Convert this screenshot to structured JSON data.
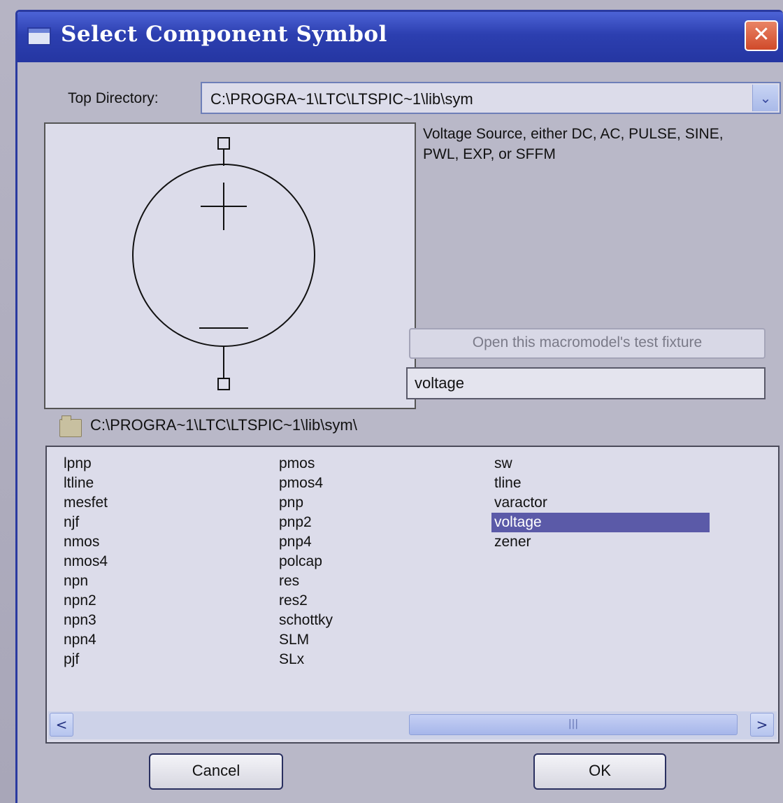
{
  "window": {
    "title": "Select Component Symbol",
    "close_label": "✕"
  },
  "top_directory": {
    "label": "Top Directory:",
    "value": "C:\\PROGRA~1\\LTC\\LTSPIC~1\\lib\\sym",
    "dropdown_arrow": "⌄"
  },
  "description": "Voltage Source, either DC, AC, PULSE, SINE, PWL, EXP, or SFFM",
  "test_fixture_button": "Open this macromodel's test fixture",
  "search": {
    "value": "voltage"
  },
  "current_path": "C:\\PROGRA~1\\LTC\\LTSPIC~1\\lib\\sym\\",
  "list": {
    "columns": [
      [
        "lpnp",
        "ltline",
        "mesfet",
        "njf",
        "nmos",
        "nmos4",
        "npn",
        "npn2",
        "npn3",
        "npn4",
        "pjf"
      ],
      [
        "pmos",
        "pmos4",
        "pnp",
        "pnp2",
        "pnp4",
        "polcap",
        "res",
        "res2",
        "schottky",
        "SLM",
        "SLx"
      ],
      [
        "sw",
        "tline",
        "varactor",
        "voltage",
        "zener"
      ]
    ],
    "selected": "voltage"
  },
  "scrollbar": {
    "left": "<",
    "right": ">",
    "grip": "|||"
  },
  "buttons": {
    "cancel": "Cancel",
    "ok": "OK"
  },
  "colors": {
    "titlebar": "#2c3fb0",
    "selection": "#5b5aa8",
    "close": "#d04a2a"
  }
}
